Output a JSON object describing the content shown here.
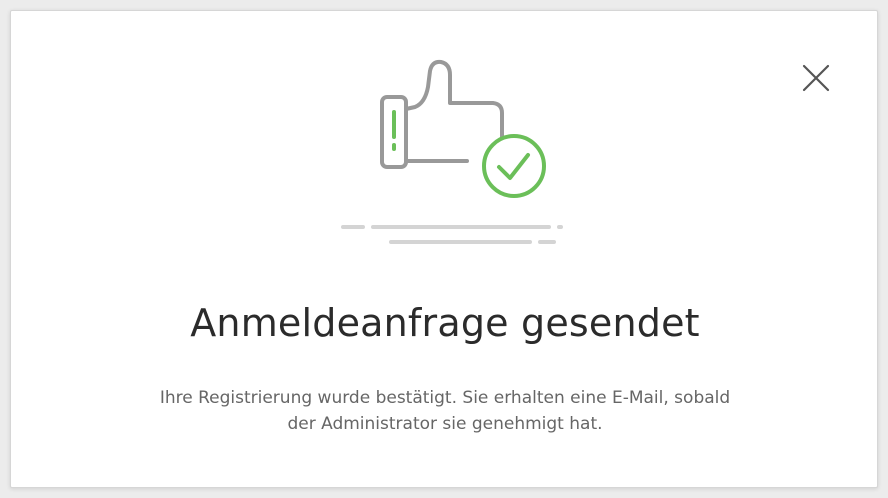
{
  "dialog": {
    "title": "Anmeldeanfrage gesendet",
    "message_line1": "Ihre Registrierung wurde bestätigt. Sie erhalten eine E-Mail, sobald",
    "message_line2": "der Administrator sie genehmigt hat.",
    "close_icon": "close-icon"
  },
  "illustration": {
    "icon": "thumbs-up-check-icon",
    "stroke_color": "#999999",
    "accent_color": "#6bbf59",
    "shadow_color": "#d4d4d4"
  }
}
